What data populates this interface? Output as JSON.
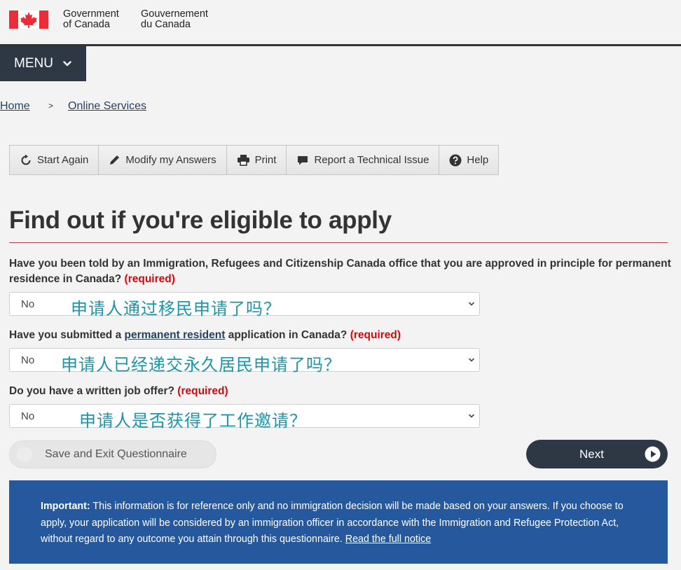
{
  "header": {
    "gov_en_line1": "Government",
    "gov_en_line2": "of Canada",
    "gov_fr_line1": "Gouvernement",
    "gov_fr_line2": "du Canada",
    "flag_color": "#eb2d37"
  },
  "menu": {
    "label": "MENU"
  },
  "breadcrumb": {
    "home": "Home",
    "separator": ">",
    "online_services": "Online Services"
  },
  "toolbar": {
    "start_again": "Start Again",
    "modify": "Modify my Answers",
    "print": "Print",
    "report": "Report a Technical Issue",
    "help": "Help"
  },
  "page": {
    "title": "Find out if you're eligible to apply"
  },
  "questions": {
    "q1": {
      "text": "Have you been told by an Immigration, Refugees and Citizenship Canada office that you are approved in principle for permanent residence in Canada?",
      "required": "(required)",
      "value": "No",
      "annotation": "申请人通过移民申请了吗？"
    },
    "q2": {
      "before": "Have you submitted a",
      "link": "permanent resident",
      "after": "application in Canada?",
      "required": "(required)",
      "value": "No",
      "annotation": "申请人已经递交永久居民申请了吗？"
    },
    "q3": {
      "text": "Do you have a written job offer?",
      "required": "(required)",
      "value": "No",
      "annotation": "申请人是否获得了工作邀请？"
    }
  },
  "actions": {
    "save_exit": "Save and Exit Questionnaire",
    "next": "Next"
  },
  "notice": {
    "label": "Important:",
    "text": "This information is for reference only and no immigration decision will be made based on your answers. If you choose to apply, your application will be considered by an immigration officer in accordance with the Immigration and Refugee Protection Act, without regard to any outcome you attain through this questionnaire.",
    "link": "Read the full notice"
  },
  "colors": {
    "nav_dark": "#2e3744",
    "link": "#284162",
    "required": "#d3080c",
    "notice_bg": "#26589e",
    "title_rule": "#af3c43",
    "annotation": "#1b95a8"
  }
}
